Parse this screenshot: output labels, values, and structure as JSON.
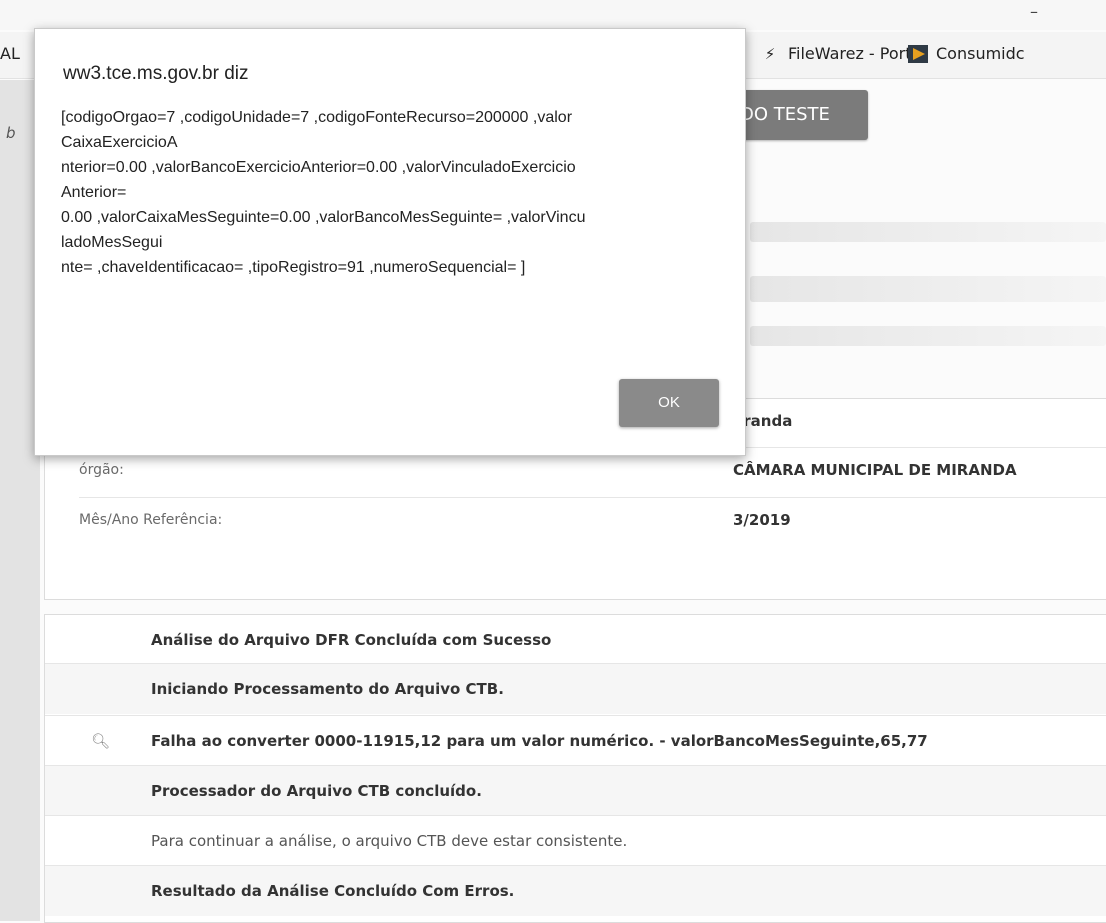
{
  "bookmarks": {
    "left_text": "AL",
    "filewarez": "FileWarez - Portal",
    "consumidor": "Consumidc"
  },
  "sidebar_letter": "b",
  "background": {
    "test_button": "DO TESTE"
  },
  "dialog": {
    "title": "ww3.tce.ms.gov.br diz",
    "message_lines": [
      "[codigoOrgao=7 ,codigoUnidade=7 ,codigoFonteRecurso=200000 ,valor",
      "CaixaExercicioA",
      "nterior=0.00 ,valorBancoExercicioAnterior=0.00 ,valorVinculadoExercicio",
      "Anterior=",
      "0.00 ,valorCaixaMesSeguinte=0.00 ,valorBancoMesSeguinte= ,valorVincu",
      "ladoMesSegui",
      "nte= ,chaveIdentificacao= ,tipoRegistro=91 ,numeroSequencial= ]"
    ],
    "ok_label": "OK"
  },
  "info": {
    "municipio_value": "liranda",
    "orgao_label": "órgão:",
    "orgao_value": "CÂMARA MUNICIPAL DE MIRANDA",
    "mes_label": "Mês/Ano Referência:",
    "mes_value": "3/2019"
  },
  "results": [
    {
      "text": "Análise do Arquivo DFR Concluída com Sucesso",
      "bold": true,
      "icon": ""
    },
    {
      "text": "Iniciando Processamento do Arquivo CTB.",
      "bold": true,
      "icon": ""
    },
    {
      "text": "Falha ao converter 0000-11915,12 para um valor numérico. - valorBancoMesSeguinte,65,77",
      "bold": true,
      "icon": "search-icon"
    },
    {
      "text": "Processador do Arquivo CTB concluído.",
      "bold": true,
      "icon": ""
    },
    {
      "text": "Para continuar a análise, o arquivo CTB deve estar consistente.",
      "bold": false,
      "icon": ""
    },
    {
      "text": "Resultado da Análise Concluído Com Erros.",
      "bold": true,
      "icon": ""
    }
  ]
}
